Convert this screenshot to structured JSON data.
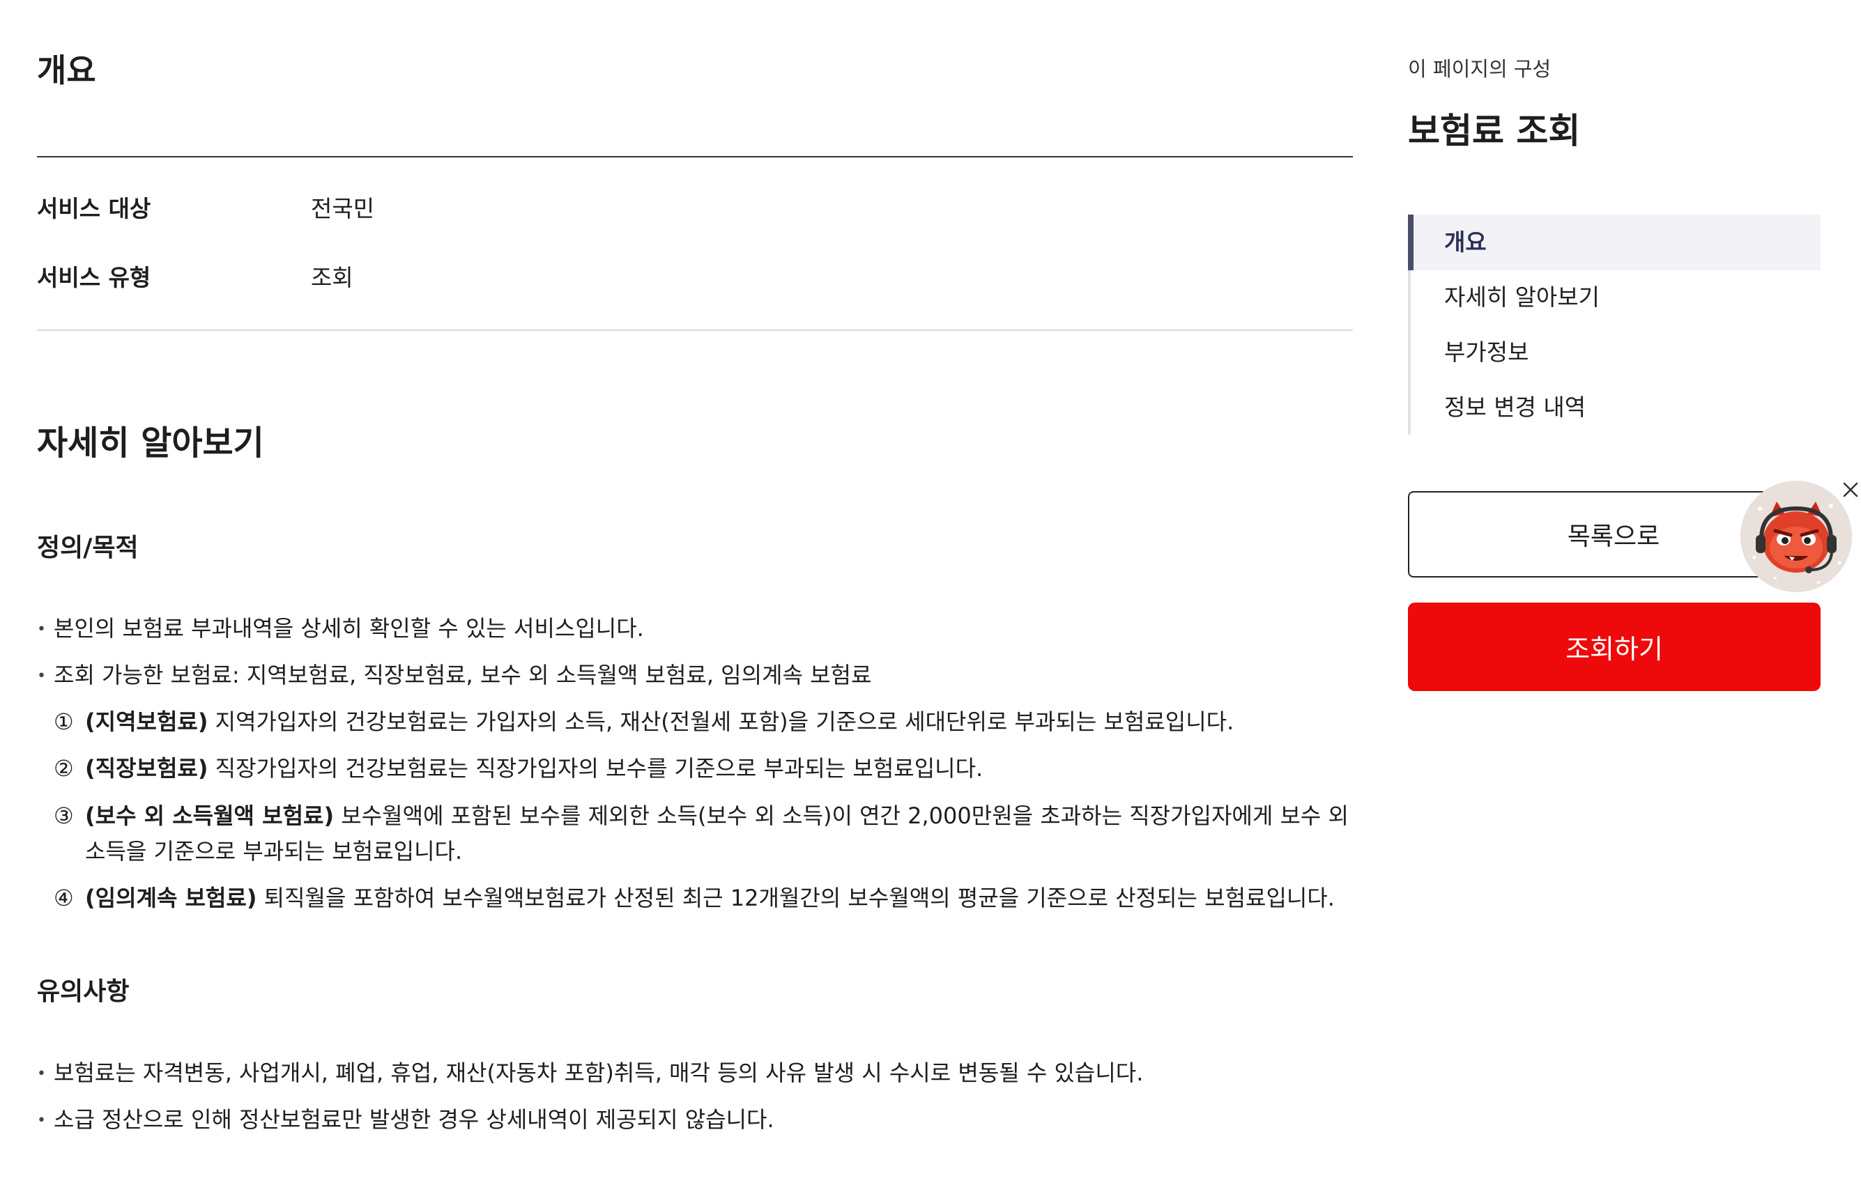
{
  "overview": {
    "title": "개요",
    "rows": [
      {
        "key": "서비스 대상",
        "value": "전국민"
      },
      {
        "key": "서비스 유형",
        "value": "조회"
      }
    ]
  },
  "detail": {
    "title": "자세히 알아보기",
    "definition": {
      "title": "정의/목적",
      "bullets": [
        "본인의 보험료 부과내역을 상세히 확인할 수 있는 서비스입니다.",
        "조회 가능한 보험료: 지역보험료, 직장보험료, 보수 외 소득월액 보험료, 임의계속 보험료"
      ],
      "items": [
        {
          "marker": "①",
          "label": "(지역보험료)",
          "text": "지역가입자의 건강보험료는 가입자의 소득, 재산(전월세 포함)을 기준으로 세대단위로 부과되는 보험료입니다."
        },
        {
          "marker": "②",
          "label": "(직장보험료)",
          "text": "직장가입자의 건강보험료는 직장가입자의 보수를 기준으로 부과되는 보험료입니다."
        },
        {
          "marker": "③",
          "label": "(보수 외 소득월액 보험료)",
          "text": "보수월액에 포함된 보수를 제외한 소득(보수 외 소득)이 연간 2,000만원을 초과하는 직장가입자에게 보수 외 소득을 기준으로 부과되는 보험료입니다."
        },
        {
          "marker": "④",
          "label": "(임의계속 보험료)",
          "text": "퇴직월을 포함하여 보수월액보험료가 산정된 최근 12개월간의 보수월액의 평균을 기준으로 산정되는 보험료입니다."
        }
      ]
    },
    "notes": {
      "title": "유의사항",
      "bullets": [
        "보험료는 자격변동, 사업개시, 폐업, 휴업, 재산(자동차 포함)취득, 매각 등의 사유 발생 시 수시로 변동될 수 있습니다.",
        "소급 정산으로 인해 정산보험료만 발생한 경우 상세내역이 제공되지 않습니다."
      ]
    }
  },
  "sidebar": {
    "caption": "이 페이지의 구성",
    "title": "보험료 조회",
    "toc": [
      "개요",
      "자세히 알아보기",
      "부가정보",
      "정보 변경 내역"
    ],
    "active_index": 0,
    "list_button": "목록으로",
    "query_button": "조회하기",
    "chatbot_icon": "chatbot-mascot-icon",
    "close_icon": "close-icon"
  },
  "colors": {
    "accent_red": "#ee0a0a",
    "toc_active_bg": "#f2f2f7",
    "toc_active_bar": "#4a4e6a"
  }
}
